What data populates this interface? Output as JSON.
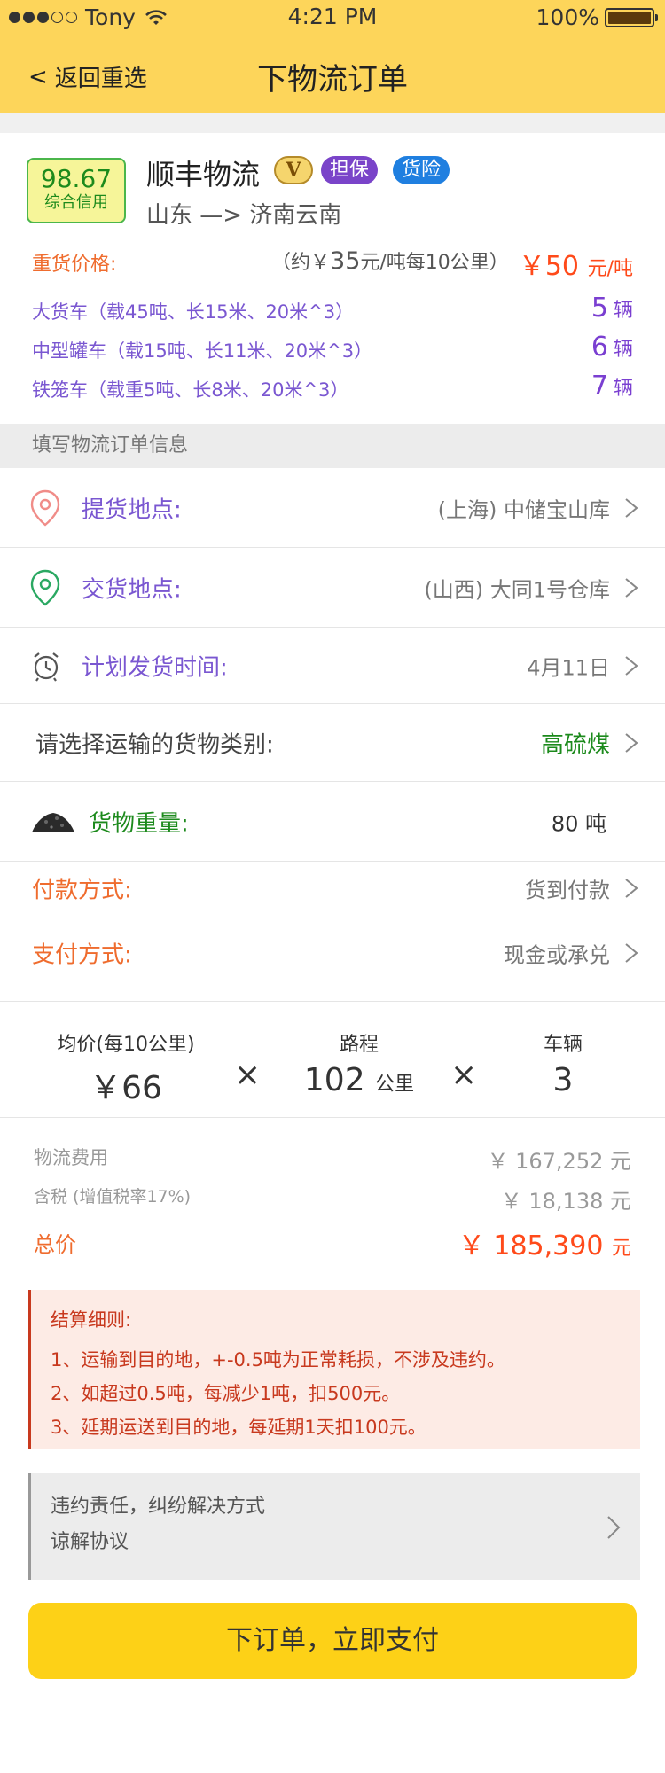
{
  "status_bar": {
    "carrier": "Tony",
    "time": "4:21 PM",
    "battery": "100%"
  },
  "nav": {
    "back_label": "返回重选",
    "title": "下物流订单"
  },
  "carrier_info": {
    "credit_score": "98.67",
    "credit_label": "综合信用",
    "company": "顺丰物流",
    "v_badge": "V",
    "tags": [
      "担保",
      "货险"
    ],
    "route": "山东 —> 济南云南"
  },
  "pricing": {
    "label": "重货价格:",
    "approx_prefix": "（约￥",
    "approx_value": "35",
    "approx_suffix": "元/吨每10公里）",
    "price_value": "￥50",
    "price_unit": "元/吨"
  },
  "trucks": [
    {
      "name": "大货车（载45吨、长15米、20米^3）",
      "count": "5",
      "unit": "辆"
    },
    {
      "name": "中型罐车（载15吨、长11米、20米^3）",
      "count": "6",
      "unit": "辆"
    },
    {
      "name": "铁笼车（载重5吨、长8米、20米^3）",
      "count": "7",
      "unit": "辆"
    }
  ],
  "section_title": "填写物流订单信息",
  "form": {
    "pickup": {
      "label": "提货地点:",
      "value": "(上海) 中储宝山库"
    },
    "delivery": {
      "label": "交货地点:",
      "value": "(山西) 大同1号仓库"
    },
    "ship_time": {
      "label": "计划发货时间:",
      "value": "4月11日"
    },
    "cargo_type": {
      "label": "请选择运输的货物类别:",
      "value": "高硫煤"
    },
    "cargo_weight": {
      "label": "货物重量:",
      "value": "80 吨"
    },
    "payment_method": {
      "label": "付款方式:",
      "value": "货到付款"
    },
    "pay_type": {
      "label": "支付方式:",
      "value": "现金或承兑"
    }
  },
  "calc": {
    "avg_label": "均价(每10公里)",
    "avg_value": "￥66",
    "distance_label": "路程",
    "distance_value": "102",
    "distance_unit": "公里",
    "vehicles_label": "车辆",
    "vehicles_value": "3",
    "times_sign": "×"
  },
  "fees": {
    "logistics_label": "物流费用",
    "logistics_value": "￥ 167,252 元",
    "tax_label": "含税 (增值税率17%)",
    "tax_value": "￥ 18,138 元",
    "total_label": "总价",
    "total_value": "￥ 185,390",
    "total_unit": "元"
  },
  "rules": {
    "title": "结算细则:",
    "items": [
      "1、运输到目的地，+-0.5吨为正常耗损，不涉及违约。",
      "2、如超过0.5吨，每减少1吨，扣500元。",
      "3、延期运送到目的地，每延期1天扣100元。"
    ]
  },
  "breach": {
    "line1": "违约责任，纠纷解决方式",
    "line2": "谅解协议"
  },
  "submit_label": "下订单，立即支付",
  "colors": {
    "header": "#fdd55a",
    "price_red": "#ff4a1a",
    "purple": "#7a57d1",
    "green": "#1c8a1c",
    "orange": "#ef6c2e",
    "submit": "#fdd117"
  }
}
